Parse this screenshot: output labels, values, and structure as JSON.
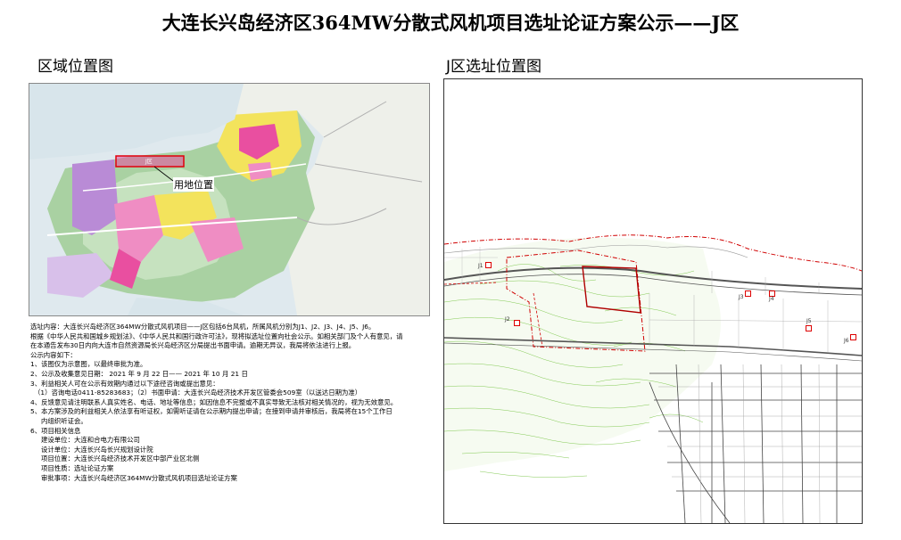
{
  "page": {
    "title": "大连长兴岛经济区364MW分散式风机项目选址论证方案公示——J区",
    "left_heading": "区域位置图",
    "right_heading": "J区选址位置图"
  },
  "left_map": {
    "site_label": "用地位置",
    "site_mark": "J区",
    "colors": {
      "sea": "#dfe9ee",
      "land": "#f4f4f0",
      "green": "#9fc99a",
      "yellow": "#f3e35c",
      "pink": "#e94fa0",
      "purple": "#b98bd6",
      "site_outline": "#e0000a"
    }
  },
  "right_map": {
    "turbines": [
      "J1",
      "J2",
      "J3",
      "J4",
      "J5",
      "J6"
    ],
    "colors": {
      "red_boundary": "#d00000",
      "green_contour": "#76c442",
      "road": "#555555"
    }
  },
  "notes": {
    "lines": [
      "选址内容：大连长兴岛经济区364MW分散式风机项目——J区包括6台风机，所属风机分别为J1、J2、J3、J4、J5、J6。",
      "根据《中华人民共和国城乡规划法》、《中华人民共和国行政许可法》，现将拟选址位置向社会公示。如相关部门及个人有意见，请",
      "在本通告发布30日内向大连市自然资源局长兴岛经济区分局提出书面申请。逾期无异议，我局将依法进行上报。",
      "公示内容如下：",
      "1、该图仅为示意图，以最终审批为准。",
      "2、公示及收集意见日期：   2021 年 9 月 22 日——  2021  年  10  月  21 日",
      "3、利益相关人可在公示有效期内通过以下途径咨询或提出意见：",
      "（1）咨询电话0411-85283683；（2）书面申请：大连长兴岛经济技术开发区管委会509室（以送达日期为准）",
      "4、反馈意见请注明联系人真实姓名、电话、地址等信息；如因信息不完整或不真实导致无法核对相关情况的，视为无效意见。",
      "5、本方案涉及的利益相关人依法享有听证权，如需听证请在公示期内提出申请；在接到申请并审核后，我局将在15个工作日",
      "内组织听证会。",
      "6、项目相关信息",
      "建设单位：大连和合电力有限公司",
      "设计单位：大连长兴岛长兴规划设计院",
      "项目位置：大连长兴岛经济技术开发区中部产业区北侧",
      "项目性质：选址论证方案",
      "审批事项：大连长兴岛经济区364MW分散式风机项目选址论证方案"
    ]
  }
}
